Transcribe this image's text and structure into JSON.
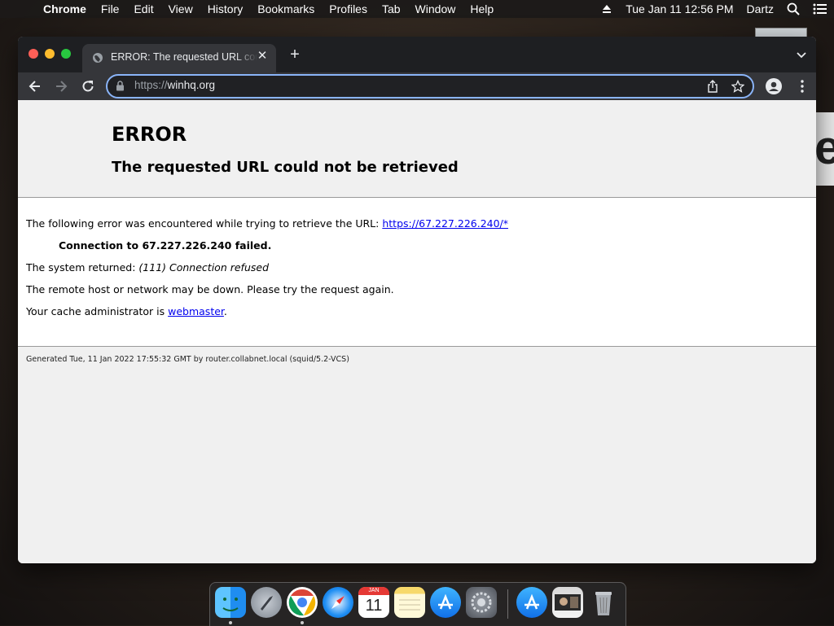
{
  "menubar": {
    "app_name": "Chrome",
    "items": [
      "File",
      "Edit",
      "View",
      "History",
      "Bookmarks",
      "Profiles",
      "Tab",
      "Window",
      "Help"
    ],
    "datetime": "Tue Jan 11  12:56 PM",
    "user": "Dartz",
    "status_icons": [
      "eject-icon",
      "spotlight-search-icon",
      "control-center-icon"
    ]
  },
  "browser": {
    "tab": {
      "title": "ERROR: The requested URL could not be retrieved",
      "icon": "globe-icon"
    },
    "address": {
      "scheme": "https://",
      "host": "winhq.org"
    }
  },
  "page": {
    "heading": "ERROR",
    "subheading": "The requested URL could not be retrieved",
    "line1_prefix": "The following error was encountered while trying to retrieve the URL: ",
    "line1_link": "https://67.227.226.240/*",
    "line2": "Connection to 67.227.226.240 failed.",
    "line3_prefix": "The system returned: ",
    "line3_error": "(111) Connection refused",
    "line4": "The remote host or network may be down. Please try the request again.",
    "line5_prefix": "Your cache administrator is ",
    "line5_link": "webmaster",
    "line5_suffix": ".",
    "footer": "Generated Tue, 11 Jan 2022 17:55:32 GMT by router.collabnet.local (squid/5.2-VCS)"
  },
  "dock": {
    "apps": [
      "Finder",
      "Launchpad",
      "Google Chrome",
      "Safari",
      "Calendar",
      "Notes",
      "App Store",
      "System Preferences",
      "Downloads",
      "Recent Document",
      "Trash"
    ],
    "calendar_month": "JAN",
    "calendar_day": "11"
  }
}
